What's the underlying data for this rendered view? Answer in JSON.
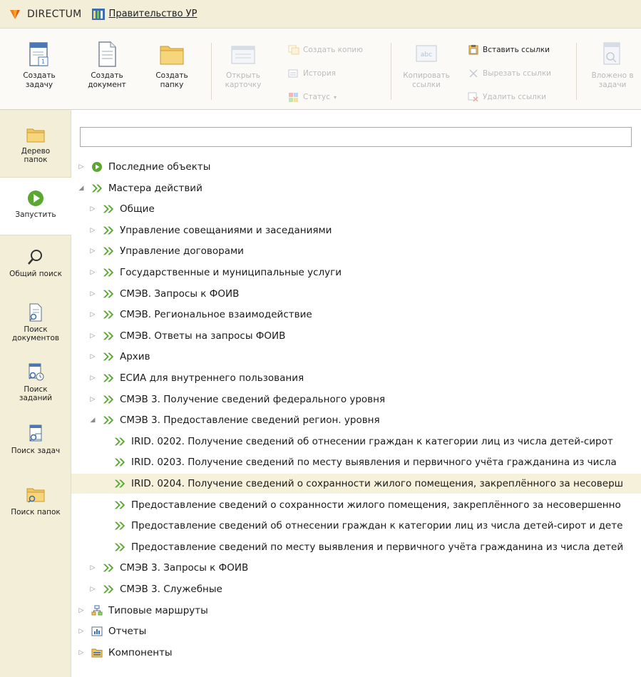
{
  "titlebar": {
    "brand": "DIRECTUM",
    "gov_link": "Правительство УР"
  },
  "ribbon": {
    "create_task": [
      "Создать",
      "задачу"
    ],
    "create_document": [
      "Создать",
      "документ"
    ],
    "create_folder": [
      "Создать",
      "папку"
    ],
    "open_card": [
      "Открыть",
      "карточку"
    ],
    "create_copy": "Создать копию",
    "history": "История",
    "status": "Статус",
    "copy_links": [
      "Копировать",
      "ссылки"
    ],
    "paste_links": "Вставить ссылки",
    "cut_links": "Вырезать ссылки",
    "delete_links": "Удалить ссылки",
    "attached_to_tasks": [
      "Вложено в",
      "задачи"
    ]
  },
  "leftnav": {
    "items": [
      {
        "label": "Дерево папок",
        "lines": [
          "Дерево",
          "папок"
        ]
      },
      {
        "label": "Запустить",
        "lines": [
          "Запустить"
        ]
      },
      {
        "label": "Общий поиск",
        "lines": [
          "Общий поиск"
        ]
      },
      {
        "label": "Поиск документов",
        "lines": [
          "Поиск",
          "документов"
        ]
      },
      {
        "label": "Поиск заданий",
        "lines": [
          "Поиск",
          "заданий"
        ]
      },
      {
        "label": "Поиск задач",
        "lines": [
          "Поиск задач"
        ]
      },
      {
        "label": "Поиск папок",
        "lines": [
          "Поиск папок"
        ]
      }
    ]
  },
  "search": {
    "value": "",
    "placeholder": ""
  },
  "tree": {
    "rows": [
      {
        "label": "Последние объекты",
        "level": 0,
        "expander": "collapsed",
        "icon": "play-icon"
      },
      {
        "label": "Мастера действий",
        "level": 0,
        "expander": "expanded",
        "icon": "wizard-icon"
      },
      {
        "label": "Общие",
        "level": 1,
        "expander": "collapsed",
        "icon": "wizard-icon"
      },
      {
        "label": "Управление совещаниями и заседаниями",
        "level": 1,
        "expander": "collapsed",
        "icon": "wizard-icon"
      },
      {
        "label": "Управление договорами",
        "level": 1,
        "expander": "collapsed",
        "icon": "wizard-icon"
      },
      {
        "label": "Государственные и муниципальные услуги",
        "level": 1,
        "expander": "collapsed",
        "icon": "wizard-icon"
      },
      {
        "label": "СМЭВ. Запросы к ФОИВ",
        "level": 1,
        "expander": "collapsed",
        "icon": "wizard-icon"
      },
      {
        "label": "СМЭВ. Региональное взаимодействие",
        "level": 1,
        "expander": "collapsed",
        "icon": "wizard-icon"
      },
      {
        "label": "СМЭВ. Ответы на запросы ФОИВ",
        "level": 1,
        "expander": "collapsed",
        "icon": "wizard-icon"
      },
      {
        "label": "Архив",
        "level": 1,
        "expander": "collapsed",
        "icon": "wizard-icon"
      },
      {
        "label": "ЕСИА для внутреннего пользования",
        "level": 1,
        "expander": "collapsed",
        "icon": "wizard-icon"
      },
      {
        "label": "СМЭВ 3. Получение сведений федерального уровня",
        "level": 1,
        "expander": "collapsed",
        "icon": "wizard-icon"
      },
      {
        "label": "СМЭВ 3. Предоставление сведений регион. уровня",
        "level": 1,
        "expander": "expanded",
        "icon": "wizard-icon"
      },
      {
        "label": "IRID. 0202. Получение сведений об отнесении граждан к категории лиц из числа детей-сирот",
        "level": 2,
        "expander": "none",
        "icon": "wizard-icon"
      },
      {
        "label": "IRID. 0203. Получение сведений по месту выявления и первичного учёта гражданина из числа",
        "level": 2,
        "expander": "none",
        "icon": "wizard-icon"
      },
      {
        "label": "IRID. 0204. Получение сведений о сохранности жилого помещения, закреплённого за несоверш",
        "level": 2,
        "expander": "none",
        "icon": "wizard-icon",
        "selected": true
      },
      {
        "label": "Предоставление сведений о сохранности жилого помещения, закреплённого за несовершенно",
        "level": 2,
        "expander": "none",
        "icon": "wizard-icon"
      },
      {
        "label": "Предоставление сведений об отнесении граждан к категории лиц из числа детей-сирот и дете",
        "level": 2,
        "expander": "none",
        "icon": "wizard-icon"
      },
      {
        "label": "Предоставление сведений по месту выявления и первичного учёта гражданина из числа детей",
        "level": 2,
        "expander": "none",
        "icon": "wizard-icon"
      },
      {
        "label": "СМЭВ 3. Запросы к ФОИВ",
        "level": 1,
        "expander": "collapsed",
        "icon": "wizard-icon"
      },
      {
        "label": "СМЭВ 3. Служебные",
        "level": 1,
        "expander": "collapsed",
        "icon": "wizard-icon"
      },
      {
        "label": "Типовые маршруты",
        "level": 0,
        "expander": "collapsed",
        "icon": "route-icon"
      },
      {
        "label": "Отчеты",
        "level": 0,
        "expander": "collapsed",
        "icon": "report-icon"
      },
      {
        "label": "Компоненты",
        "level": 0,
        "expander": "collapsed",
        "icon": "components-icon"
      }
    ]
  },
  "colors": {
    "panel_bg": "#f3eed7",
    "wizard_green": "#5aa832",
    "selected_row": "#f6f1db"
  }
}
